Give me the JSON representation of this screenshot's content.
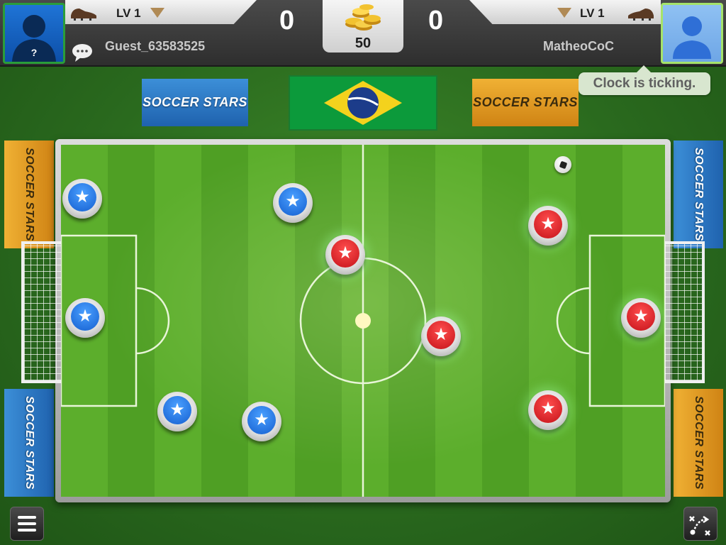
{
  "hud": {
    "player_left": {
      "level": "LV 1",
      "name": "Guest_63583525",
      "score": "0"
    },
    "player_right": {
      "level": "LV 1",
      "name": "MatheoCoC",
      "score": "0"
    },
    "coins": "50",
    "unknown_avatar_mark": "?"
  },
  "toast": {
    "text": "Clock is ticking."
  },
  "banners": {
    "brand_text": "SOCCER STARS"
  },
  "icons": {
    "avatar_left": "unknown-user-silhouette-icon",
    "avatar_right": "default-user-icon",
    "cleat": "soccer-cleat-icon",
    "chat": "chat-bubble-icon",
    "coins": "gold-coin-stack-icon",
    "menu": "hamburger-menu-icon",
    "tactics": "tactics-formation-icon",
    "flag": "brazil-flag-icon",
    "ball": "soccer-ball-icon",
    "star": "★"
  },
  "teams": {
    "left_color": "#155fd0",
    "right_color": "#c4121a",
    "left_count": 5,
    "right_count": 5
  },
  "colors": {
    "pitch_light": "#5cae2c",
    "pitch_dark": "#4f9f24",
    "hud_bg": "#2e2e2e",
    "brazil_green": "#0c9a3b",
    "brazil_yellow": "#f4d21d",
    "brazil_blue": "#1c3c8a"
  }
}
